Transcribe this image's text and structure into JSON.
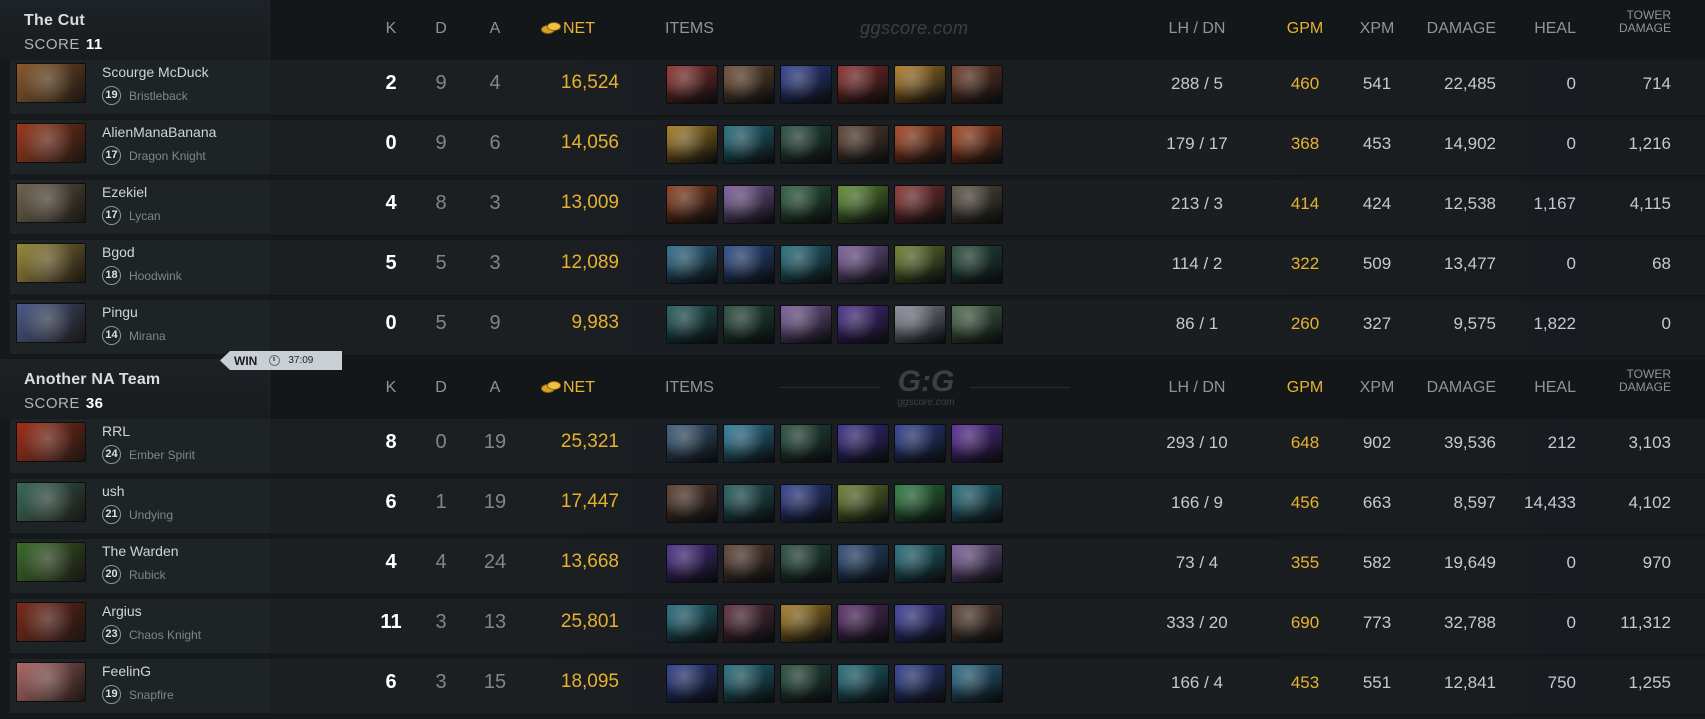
{
  "columns": {
    "k": "K",
    "d": "D",
    "a": "A",
    "net": "NET",
    "items": "ITEMS",
    "lh_dn": "LH  /  DN",
    "gpm": "GPM",
    "xpm": "XPM",
    "damage": "DAMAGE",
    "heal": "HEAL",
    "tower_damage_l1": "TOWER",
    "tower_damage_l2": "DAMAGE"
  },
  "watermark_text": "ggscore.com",
  "watermark_logo": "G:G",
  "watermark_logo_sub": "ggscore.com",
  "colors": {
    "gold": "#e8b32e",
    "background": "#15191c",
    "win_badge": "#c9cfd4"
  },
  "teams": [
    {
      "name": "The Cut",
      "score_label": "SCORE",
      "score": "11",
      "players": [
        {
          "name": "Scourge McDuck",
          "level": "19",
          "hero": "Bristleback",
          "k": "2",
          "d": "9",
          "a": "4",
          "net": "16,524",
          "lh_dn": "288  /  5",
          "gpm": "460",
          "xpm": "541",
          "damage": "22,485",
          "heal": "0",
          "tower": "714",
          "portrait_color": "#8a5a2b",
          "items": [
            "#8f2f2a",
            "#6b4a2f",
            "#2c3c8e",
            "#8b2a28",
            "#b07a1f",
            "#6a3620"
          ]
        },
        {
          "name": "AlienManaBanana",
          "level": "17",
          "hero": "Dragon Knight",
          "k": "0",
          "d": "9",
          "a": "6",
          "net": "14,056",
          "lh_dn": "179  /  17",
          "gpm": "368",
          "xpm": "453",
          "damage": "14,902",
          "heal": "0",
          "tower": "1,216",
          "portrait_color": "#9c3a1d",
          "items": [
            "#a47a1c",
            "#1f6b7a",
            "#234b3a",
            "#5c4030",
            "#a5401a",
            "#a5401a"
          ]
        },
        {
          "name": "Ezekiel",
          "level": "17",
          "hero": "Lycan",
          "k": "4",
          "d": "8",
          "a": "3",
          "net": "13,009",
          "lh_dn": "213  /  3",
          "gpm": "414",
          "xpm": "424",
          "damage": "12,538",
          "heal": "1,167",
          "tower": "4,115",
          "portrait_color": "#6e6450",
          "items": [
            "#8b3a1a",
            "#7a5a9a",
            "#2a5a3a",
            "#5a8a2a",
            "#8a3030",
            "#5a5040"
          ]
        },
        {
          "name": "Bgod",
          "level": "18",
          "hero": "Hoodwink",
          "k": "5",
          "d": "5",
          "a": "3",
          "net": "12,089",
          "lh_dn": "114  /  2",
          "gpm": "322",
          "xpm": "509",
          "damage": "13,477",
          "heal": "0",
          "tower": "68",
          "portrait_color": "#9a8a3a",
          "items": [
            "#2a6a8a",
            "#2a4a8a",
            "#1f6b7a",
            "#7a5a9a",
            "#6a7a2a",
            "#234b3a"
          ]
        },
        {
          "name": "Pingu",
          "level": "14",
          "hero": "Mirana",
          "k": "0",
          "d": "5",
          "a": "9",
          "net": "9,983",
          "lh_dn": "86  /  1",
          "gpm": "260",
          "xpm": "327",
          "damage": "9,575",
          "heal": "1,822",
          "tower": "0",
          "portrait_color": "#4a5a8a",
          "items": [
            "#1f5a5a",
            "#234b3a",
            "#7a5a9a",
            "#4a2a8a",
            "#8a8a9a",
            "#4a6a4a"
          ]
        }
      ]
    },
    {
      "name": "Another NA Team",
      "score_label": "SCORE",
      "score": "36",
      "result": "WIN",
      "duration": "37:09",
      "players": [
        {
          "name": "RRL",
          "level": "24",
          "hero": "Ember Spirit",
          "k": "8",
          "d": "0",
          "a": "19",
          "net": "25,321",
          "lh_dn": "293  /  10",
          "gpm": "648",
          "xpm": "902",
          "damage": "39,536",
          "heal": "212",
          "tower": "3,103",
          "portrait_color": "#a0301a",
          "items": [
            "#3a5a7a",
            "#2a7a9a",
            "#234b3a",
            "#3a2a8a",
            "#2c3c8e",
            "#5a2a9a"
          ]
        },
        {
          "name": "ush",
          "level": "21",
          "hero": "Undying",
          "k": "6",
          "d": "1",
          "a": "19",
          "net": "17,447",
          "lh_dn": "166  /  9",
          "gpm": "456",
          "xpm": "663",
          "damage": "8,597",
          "heal": "14,433",
          "tower": "4,102",
          "portrait_color": "#3a6a5a",
          "items": [
            "#5a3a2a",
            "#1f5a5a",
            "#2c3c8e",
            "#6a7a2a",
            "#2a7a3a",
            "#1f6b7a"
          ]
        },
        {
          "name": "The Warden",
          "level": "20",
          "hero": "Rubick",
          "k": "4",
          "d": "4",
          "a": "24",
          "net": "13,668",
          "lh_dn": "73  /  4",
          "gpm": "355",
          "xpm": "582",
          "damage": "19,649",
          "heal": "0",
          "tower": "970",
          "portrait_color": "#3a6a2a",
          "items": [
            "#4a2a8a",
            "#5c4030",
            "#234b3a",
            "#2a4a7a",
            "#1f6b7a",
            "#7a5a9a"
          ]
        },
        {
          "name": "Argius",
          "level": "23",
          "hero": "Chaos Knight",
          "k": "11",
          "d": "3",
          "a": "13",
          "net": "25,801",
          "lh_dn": "333  /  20",
          "gpm": "690",
          "xpm": "773",
          "damage": "32,788",
          "heal": "0",
          "tower": "11,312",
          "portrait_color": "#7a2a1a",
          "items": [
            "#1f6b7a",
            "#5a2a3a",
            "#a47a1c",
            "#5a2a6a",
            "#3a3a9a",
            "#5c4030"
          ]
        },
        {
          "name": "FeelinG",
          "level": "19",
          "hero": "Snapfire",
          "k": "6",
          "d": "3",
          "a": "15",
          "net": "18,095",
          "lh_dn": "166  /  4",
          "gpm": "453",
          "xpm": "551",
          "damage": "12,841",
          "heal": "750",
          "tower": "1,255",
          "portrait_color": "#b06a6a",
          "items": [
            "#2a3a8a",
            "#1f6b7a",
            "#234b3a",
            "#1f6b7a",
            "#2c3c8e",
            "#2a6a8a"
          ]
        }
      ]
    }
  ]
}
